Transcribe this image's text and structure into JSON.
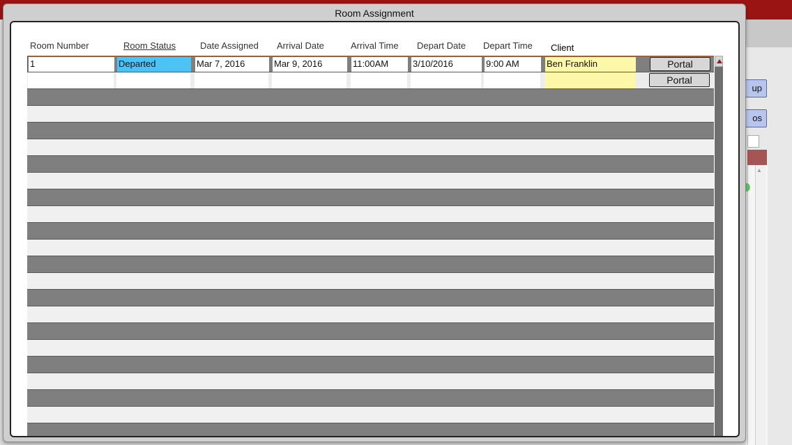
{
  "dialog": {
    "title": "Room Assignment"
  },
  "columns": {
    "room_number": "Room Number",
    "room_status": "Room Status",
    "date_assigned": "Date Assigned",
    "arrival_date": "Arrival Date",
    "arrival_time": "Arrival Time",
    "depart_date": "Depart Date",
    "depart_time": "Depart Time",
    "client": "Client"
  },
  "rows": [
    {
      "room_number": "1",
      "room_status": "Departed",
      "date_assigned": "Mar 7, 2016",
      "arrival_date": "Mar 9, 2016",
      "arrival_time": "11:00AM",
      "depart_date": "3/10/2016",
      "depart_time": "9:00 AM",
      "client": "Ben Franklin",
      "portal_label": "Portal"
    },
    {
      "room_number": "",
      "room_status": "",
      "date_assigned": "",
      "arrival_date": "",
      "arrival_time": "",
      "depart_date": "",
      "depart_time": "",
      "client": "",
      "portal_label": "Portal"
    }
  ],
  "background": {
    "button_1": "up",
    "button_2": "os"
  },
  "colors": {
    "status_departed": "#4dc3f5",
    "client_field": "#fdf8a9",
    "top_bar": "#9b1414",
    "stripe_dark": "#7f7f7f"
  }
}
